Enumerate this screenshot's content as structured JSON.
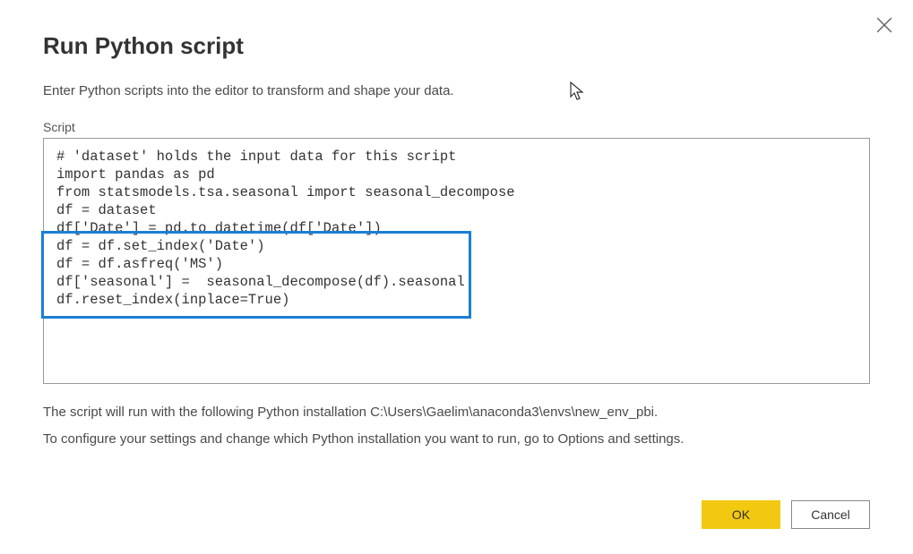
{
  "dialog": {
    "title": "Run Python script",
    "instruction": "Enter Python scripts into the editor to transform and shape your data.",
    "script_label": "Script",
    "script_content": "# 'dataset' holds the input data for this script\nimport pandas as pd\nfrom statsmodels.tsa.seasonal import seasonal_decompose\ndf = dataset\ndf['Date'] = pd.to_datetime(df['Date'])\ndf = df.set_index('Date')\ndf = df.asfreq('MS')\ndf['seasonal'] =  seasonal_decompose(df).seasonal\ndf.reset_index(inplace=True)",
    "footer_line1": "The script will run with the following Python installation C:\\Users\\Gaelim\\anaconda3\\envs\\new_env_pbi.",
    "footer_line2": "To configure your settings and change which Python installation you want to run, go to Options and settings.",
    "ok_label": "OK",
    "cancel_label": "Cancel"
  }
}
